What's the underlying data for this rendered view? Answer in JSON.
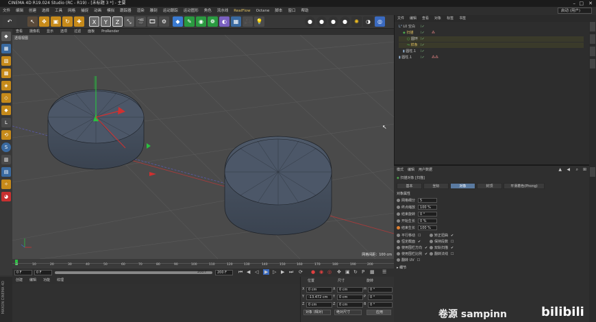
{
  "window": {
    "title": "CINEMA 4D R19.024 Studio (RC - R19) - [未标题 3 *] - 主要"
  },
  "menubar": {
    "items": [
      "文件",
      "编辑",
      "创建",
      "选择",
      "工具",
      "网格",
      "捕捉",
      "动画",
      "模拟",
      "跟踪器",
      "渲染",
      "雕刻",
      "运动跟踪",
      "运动图形",
      "角色",
      "流水线",
      "RealFlow",
      "Octane",
      "脚本",
      "窗口",
      "帮助"
    ],
    "interface_label": "界面",
    "interface_value": "启动 (用户)"
  },
  "viewport": {
    "menu": [
      "查看",
      "摄像机",
      "显示",
      "选项",
      "过滤",
      "面板",
      "ProRender"
    ],
    "label": "透视视图",
    "grid_info": "网格间距：100 cm"
  },
  "timeline": {
    "ticks": [
      "0",
      "10",
      "20",
      "30",
      "40",
      "50",
      "60",
      "70",
      "80",
      "90",
      "100",
      "110",
      "120",
      "130",
      "140",
      "150",
      "160",
      "170",
      "180",
      "190",
      "200"
    ],
    "current_frame": "0 F",
    "start_frame": "0 F",
    "end_frame": "200 F",
    "preview_end": "200 F"
  },
  "material_manager": {
    "menu": [
      "创建",
      "编辑",
      "功能",
      "纹理"
    ],
    "brand": "MAXON CINEMA 4D"
  },
  "coordinates": {
    "headers": [
      "位置",
      "尺寸",
      "旋转"
    ],
    "rows": [
      {
        "axis": "X",
        "pos": "0 cm",
        "size": "0 cm",
        "rot_axis": "H",
        "rot": "0 °"
      },
      {
        "axis": "Y",
        "pos": "-13.472 cm",
        "size": "0 cm",
        "rot_axis": "P",
        "rot": "0 °"
      },
      {
        "axis": "Z",
        "pos": "0 cm",
        "size": "0 cm",
        "rot_axis": "B",
        "rot": "0 °"
      }
    ],
    "mode_select": "对象 (相对)",
    "size_select": "绝对尺寸",
    "apply_button": "应用"
  },
  "object_manager": {
    "tabs": [
      "文件",
      "编辑",
      "查看",
      "对象",
      "标签",
      "书签"
    ],
    "objects": [
      {
        "name": "L0 空白",
        "indent": 0
      },
      {
        "name": "扫描",
        "indent": 1
      },
      {
        "name": "圆环",
        "indent": 2
      },
      {
        "name": "样条",
        "indent": 2
      },
      {
        "name": "圆柱.1",
        "indent": 1
      },
      {
        "name": "圆柱.1",
        "indent": 0
      }
    ]
  },
  "attribute_manager": {
    "menu": [
      "模式",
      "编辑",
      "用户数据"
    ],
    "object_title": "扫描对象 [扫描]",
    "tabs": [
      "基本",
      "坐标",
      "对象",
      "封顶",
      "平滑着色(Phong)"
    ],
    "active_tab": "对象",
    "section": "对象属性",
    "params": [
      {
        "label": "网格细分",
        "value": "5"
      },
      {
        "label": "终点缩放",
        "value": "100 %"
      },
      {
        "label": "结束旋转",
        "value": "0 °"
      },
      {
        "label": "开始生长",
        "value": "0 %"
      },
      {
        "label": "结束生长",
        "value": "100 %"
      }
    ],
    "checks_left": [
      "平行移动",
      "恒定截面",
      "使用围栏方向",
      "使用围栏比例",
      "翻转 UV"
    ],
    "checks_right": [
      "矫正扭曲",
      "保持段数",
      "双轨扫描",
      "翻转法线"
    ],
    "detail_section": "细节"
  },
  "watermark": {
    "text": "卷源 sampinn",
    "logo": "bilibili"
  }
}
